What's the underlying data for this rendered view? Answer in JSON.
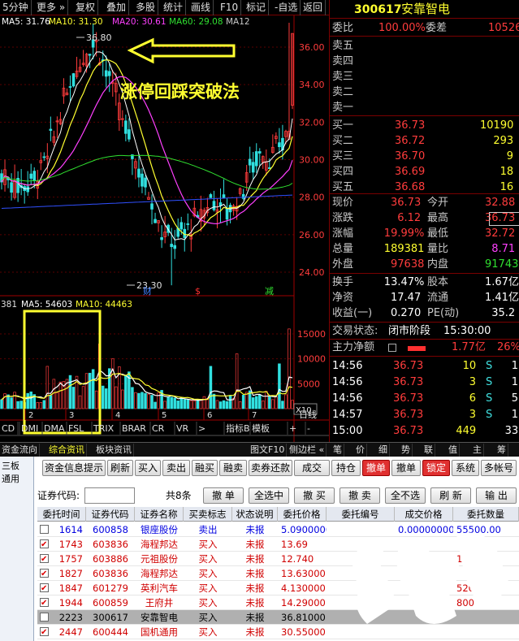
{
  "toolbar": {
    "items": [
      "5分钟",
      "更多",
      "复权",
      "叠加",
      "多股",
      "统计",
      "画线",
      "F10",
      "标记",
      "-自选",
      "返回"
    ]
  },
  "price_chart": {
    "ma_legend": [
      {
        "label": "MA5: 31.76",
        "color": "#ffffff"
      },
      {
        "label": "MA10: 31.30",
        "color": "#ffff30"
      },
      {
        "label": "MA20: 30.61",
        "color": "#ff40ff"
      },
      {
        "label": "MA60: 29.08",
        "color": "#30e030"
      },
      {
        "label": "MA12",
        "color": "#c8c8c8"
      }
    ],
    "y_ticks": [
      "36.00",
      "34.00",
      "32.00",
      "30.00",
      "28.00",
      "26.00",
      "24.00"
    ],
    "high_label": "36.80",
    "low_label": "23.30",
    "annotation_text": "涨停回踩突破法",
    "markers": [
      "财",
      "$",
      "减"
    ]
  },
  "volume_chart": {
    "legend": [
      "381",
      "MA5: 54603",
      "MA10: 44463"
    ],
    "y_ticks": [
      "15000",
      "10000",
      "5000"
    ],
    "unit": "X10",
    "x_labels": [
      "2",
      "3",
      "4",
      "5",
      "6",
      "7"
    ],
    "days_label": "日线"
  },
  "indicator_tabs": [
    "CD",
    "DMI",
    "DMA",
    "FSL",
    "TRIX",
    "BRAR",
    "CR",
    "VR",
    ">",
    "指标B",
    "模板",
    "+",
    "-"
  ],
  "bottom_tabs_left": [
    "资金流向",
    "综合资讯",
    "板块资讯"
  ],
  "bottom_tabs_right": [
    "图文F10",
    "侧边栏 «",
    "笔",
    "价",
    "细",
    "势",
    "联",
    "值",
    "主",
    "筹"
  ],
  "quote": {
    "code": "300617",
    "name": "安靠智电",
    "weibi_label": "委比",
    "weibi_value": "100.00%",
    "weicha_label": "委差",
    "weicha_value": "10526",
    "sell_levels": [
      "卖五",
      "卖四",
      "卖三",
      "卖二",
      "卖一"
    ],
    "buy_levels": [
      {
        "label": "买一",
        "price": "36.73",
        "vol": "10190"
      },
      {
        "label": "买二",
        "price": "36.72",
        "vol": "293"
      },
      {
        "label": "买三",
        "price": "36.70",
        "vol": "9"
      },
      {
        "label": "买四",
        "price": "36.69",
        "vol": "18"
      },
      {
        "label": "买五",
        "price": "36.68",
        "vol": "16"
      }
    ],
    "stats": [
      {
        "l1": "现价",
        "v1": "36.73",
        "c1": "red",
        "l2": "今开",
        "v2": "32.88",
        "c2": "red"
      },
      {
        "l1": "涨跌",
        "v1": "6.12",
        "c1": "red",
        "l2": "最高",
        "v2": "36.73",
        "c2": "red"
      },
      {
        "l1": "涨幅",
        "v1": "19.99%",
        "c1": "red",
        "l2": "最低",
        "v2": "32.72",
        "c2": "red"
      },
      {
        "l1": "总量",
        "v1": "189381",
        "c1": "yel",
        "l2": "量比",
        "v2": "8.71",
        "c2": "mag"
      },
      {
        "l1": "外盘",
        "v1": "97638",
        "c1": "red",
        "l2": "内盘",
        "v2": "91743",
        "c2": "grn"
      }
    ],
    "stats2": [
      {
        "l1": "换手",
        "v1": "13.47%",
        "l2": "股本",
        "v2": "1.67亿"
      },
      {
        "l1": "净资",
        "v1": "17.47",
        "l2": "流通",
        "v2": "1.41亿"
      },
      {
        "l1": "收益(一)",
        "v1": "0.270",
        "l2": "PE(动)",
        "v2": "35.2"
      }
    ],
    "trade_status_label": "交易状态:",
    "trade_status_value": "闭市阶段",
    "trade_status_time": "15:30:00",
    "main_net_label": "主力净额",
    "main_net_value": "1.77亿",
    "main_net_pct": "26%",
    "ticks": [
      {
        "time": "14:56",
        "price": "36.73",
        "vol": "10",
        "bs": "S",
        "n": "1"
      },
      {
        "time": "14:56",
        "price": "36.73",
        "vol": "3",
        "bs": "S",
        "n": "1"
      },
      {
        "time": "14:56",
        "price": "36.73",
        "vol": "6",
        "bs": "S",
        "n": "5"
      },
      {
        "time": "14:57",
        "price": "36.73",
        "vol": "3",
        "bs": "S",
        "n": "1"
      },
      {
        "time": "15:00",
        "price": "36.73",
        "vol": "449",
        "bs": "",
        "n": "33"
      }
    ]
  },
  "panel": {
    "left_items": [
      "三板",
      "通用"
    ],
    "buttons": [
      "资金信息提示",
      "刷新",
      "买入",
      "卖出",
      "融买",
      "融卖",
      "卖券还款",
      "成交",
      "持仓",
      "撤单",
      "撤单",
      "锁定",
      "系统",
      "多帐号"
    ],
    "code_label": "证券代码:",
    "count_text": "共8条",
    "row2_buttons": [
      "撤 单",
      "全选中",
      "撤 买",
      "撤 卖",
      "全不选",
      "刷 新",
      "输 出"
    ],
    "columns": [
      "委托时间",
      "证券代码",
      "证券名称",
      "买卖标志",
      "状态说明",
      "委托价格",
      "委托编号",
      "成交价格",
      "委托数量"
    ],
    "rows": [
      {
        "checked": false,
        "time": "1614",
        "code": "600858",
        "name": "银座股份",
        "side": "卖出",
        "status": "未报",
        "price": "5.09000000",
        "id": "",
        "deal": "0.00000000",
        "qty": "55500.00",
        "sell": true
      },
      {
        "checked": true,
        "time": "1743",
        "code": "603836",
        "name": "海程邦达",
        "side": "买入",
        "status": "未报",
        "price": "13.69",
        "id": "",
        "deal": "",
        "qty": "",
        "sell": false
      },
      {
        "checked": true,
        "time": "1757",
        "code": "603886",
        "name": "元祖股份",
        "side": "买入",
        "status": "未报",
        "price": "12.740",
        "id": "",
        "deal": "",
        "qty": "1000.0",
        "sell": false
      },
      {
        "checked": true,
        "time": "1827",
        "code": "603836",
        "name": "海程邦达",
        "side": "买入",
        "status": "未报",
        "price": "13.63000",
        "id": "",
        "deal": "",
        "qty": "",
        "sell": false
      },
      {
        "checked": true,
        "time": "1847",
        "code": "601279",
        "name": "英利汽车",
        "side": "买入",
        "status": "未报",
        "price": "4.130000",
        "id": "",
        "deal": "",
        "qty": "5200",
        "sell": false
      },
      {
        "checked": true,
        "time": "1944",
        "code": "600859",
        "name": "王府井",
        "side": "买入",
        "status": "未报",
        "price": "14.29000",
        "id": "",
        "deal": "",
        "qty": "800",
        "sell": false
      },
      {
        "checked": false,
        "time": "2223",
        "code": "300617",
        "name": "安靠智电",
        "side": "买入",
        "status": "未报",
        "price": "36.81000",
        "id": "",
        "deal": "",
        "qty": "",
        "sell": false,
        "selected": true
      },
      {
        "checked": true,
        "time": "2447",
        "code": "600444",
        "name": "国机通用",
        "side": "买入",
        "status": "未报",
        "price": "30.55000",
        "id": "",
        "deal": "",
        "qty": "",
        "sell": false
      }
    ]
  },
  "colors": {
    "up": "#ff3c3c",
    "down": "#30e0e0",
    "ma5": "#ffffff",
    "ma10": "#ffff30",
    "ma20": "#ff40ff",
    "ma60": "#30e030",
    "ma120": "#3050ff",
    "annotation": "#ffff30"
  }
}
